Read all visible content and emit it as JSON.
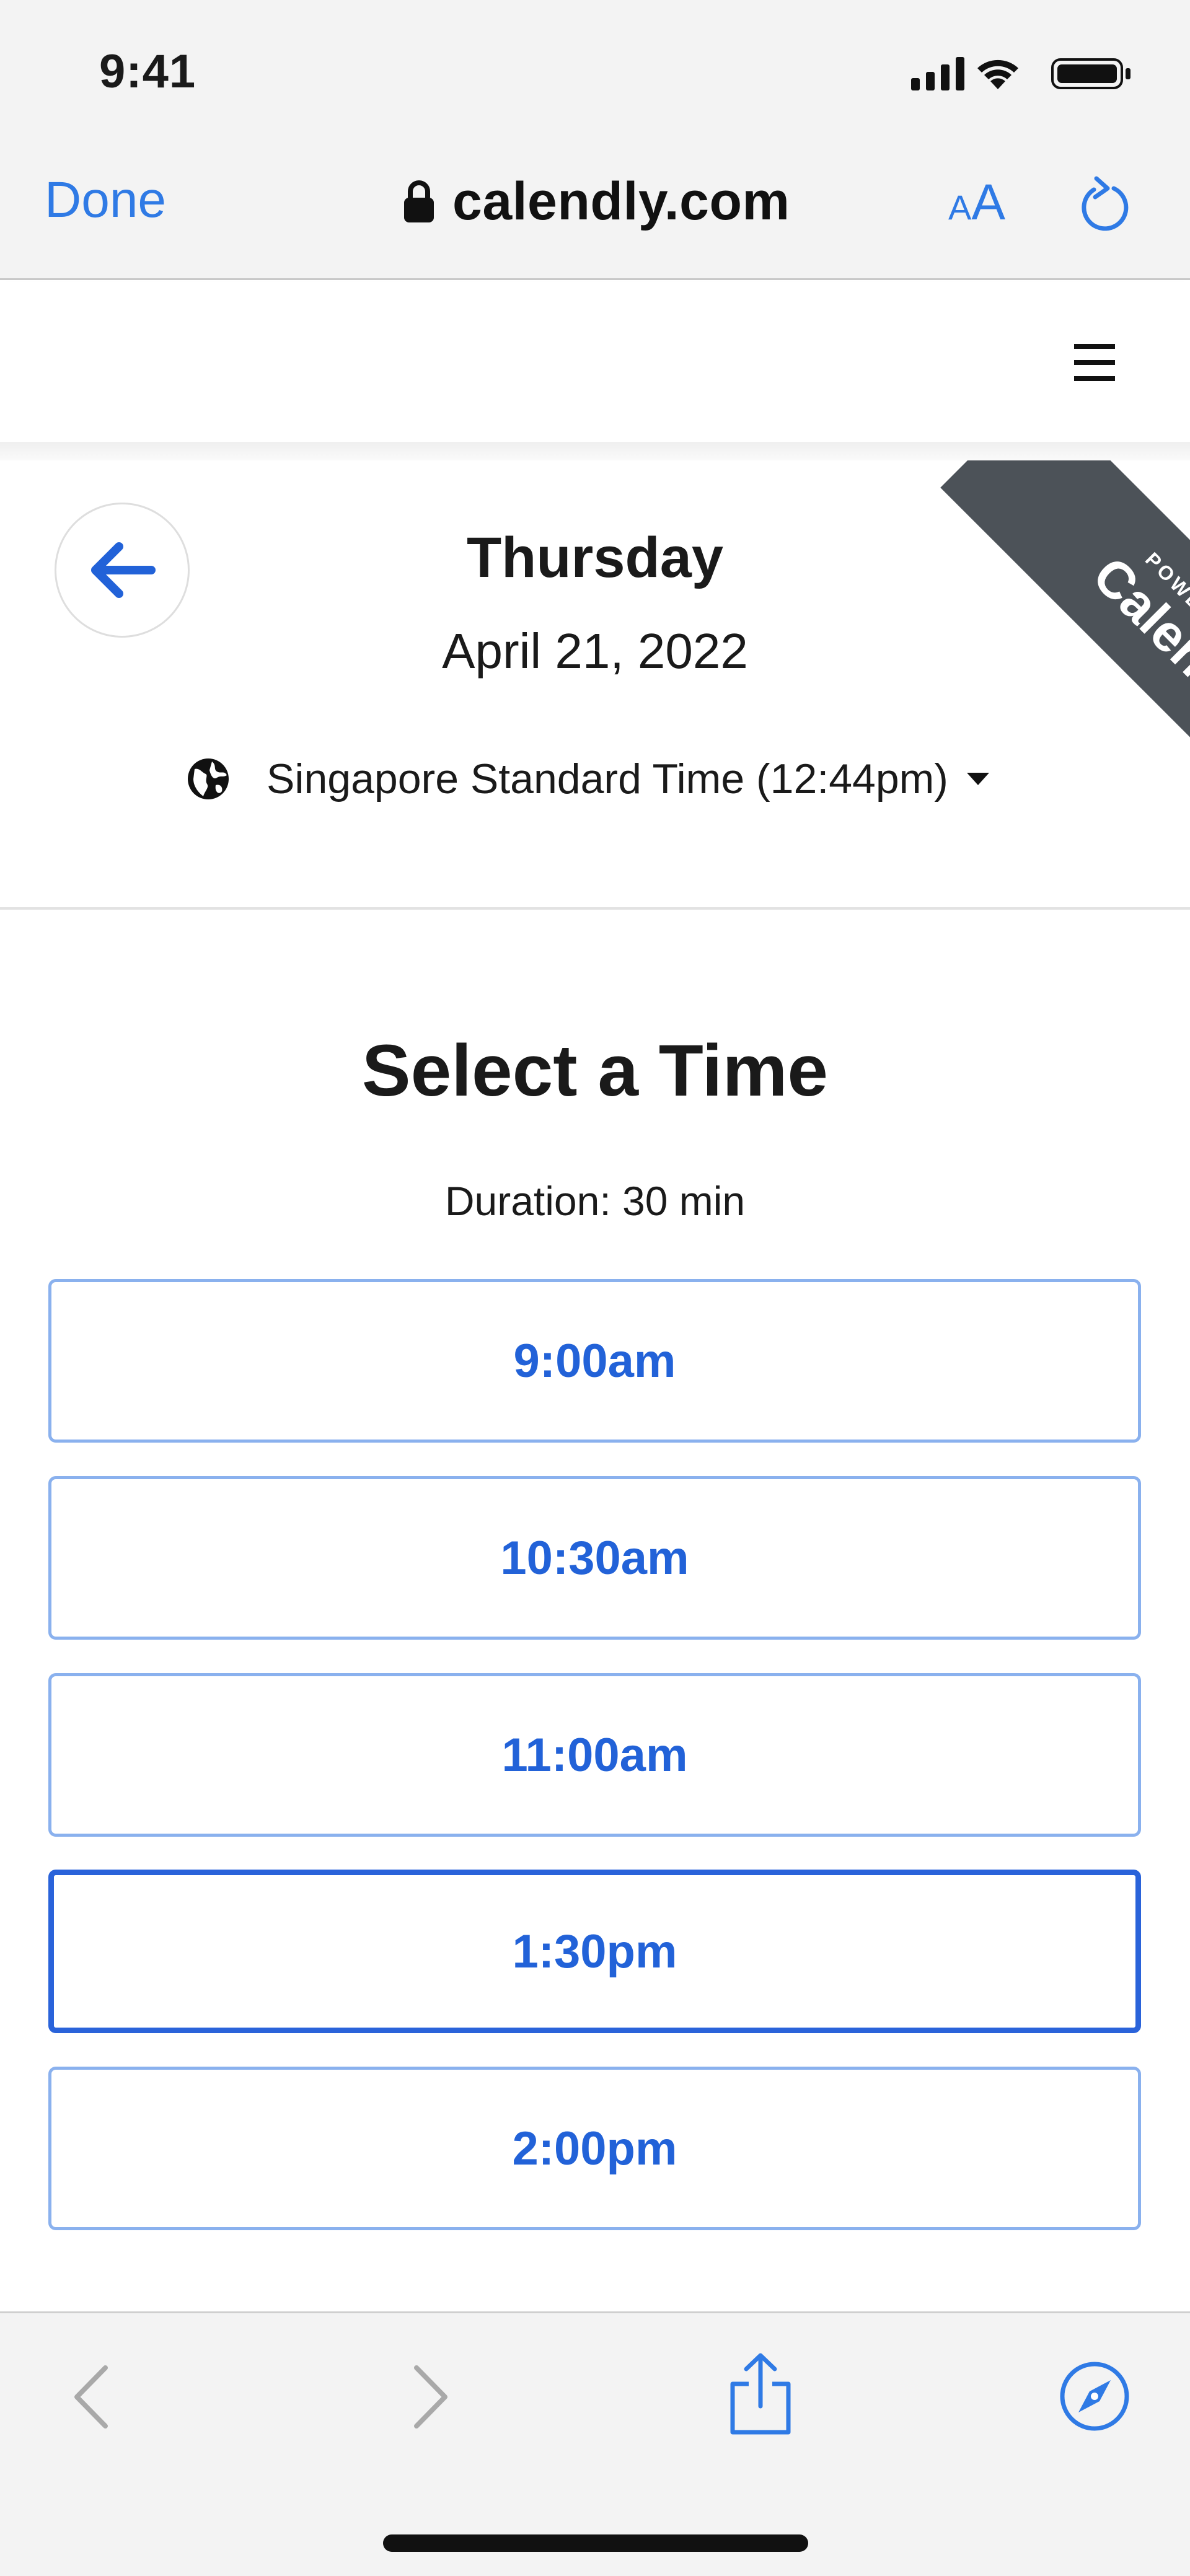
{
  "status_bar": {
    "time": "9:41"
  },
  "browser": {
    "done_label": "Done",
    "url": "calendly.com",
    "text_size_label_small": "A",
    "text_size_label_big": "A"
  },
  "header": {
    "menu_icon": "hamburger-icon"
  },
  "date_panel": {
    "day": "Thursday",
    "date": "April 21, 2022",
    "timezone": "Singapore Standard Time (12:44pm)",
    "badge_small": "POWERED BY",
    "badge_big": "Calendly"
  },
  "time_selection": {
    "title": "Select a Time",
    "duration": "Duration: 30 min",
    "slots": [
      {
        "label": "9:00am",
        "selected": false
      },
      {
        "label": "10:30am",
        "selected": false
      },
      {
        "label": "11:00am",
        "selected": false
      },
      {
        "label": "1:30pm",
        "selected": true
      },
      {
        "label": "2:00pm",
        "selected": false
      }
    ]
  },
  "toolbar": {
    "back_icon": "chevron-left-icon",
    "forward_icon": "chevron-right-icon",
    "share_icon": "share-icon",
    "compass_icon": "compass-icon"
  },
  "colors": {
    "accent": "#2f7ae5",
    "slot_text": "#2262d8",
    "slot_border": "#8ab1ee",
    "badge": "#4c5258"
  }
}
